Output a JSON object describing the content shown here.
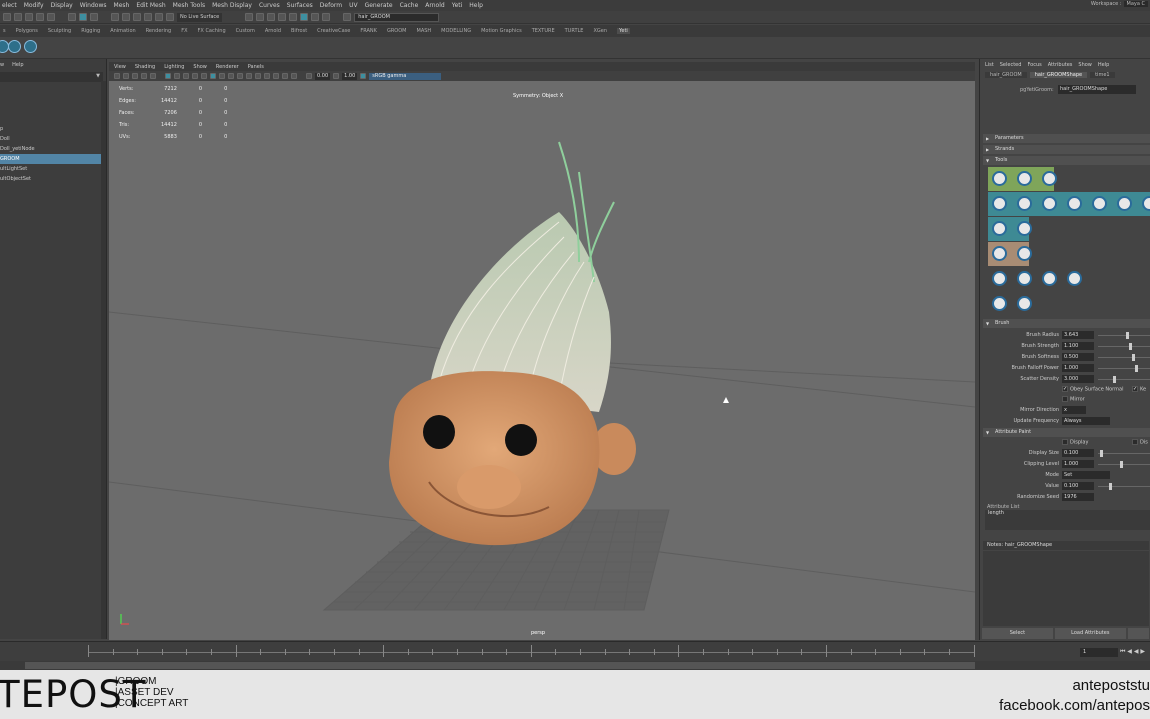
{
  "menubar": [
    "elect",
    "Modify",
    "Display",
    "Windows",
    "Mesh",
    "Edit Mesh",
    "Mesh Tools",
    "Mesh Display",
    "Curves",
    "Surfaces",
    "Deform",
    "UV",
    "Generate",
    "Cache",
    "Arnold",
    "Yeti",
    "Help"
  ],
  "workspace": {
    "label": "Workspace :",
    "value": "Maya C"
  },
  "toolbar": {
    "live_surface": "No Live Surface",
    "search_value": "hair_GROOM"
  },
  "shelf_tabs": [
    "s",
    "Polygons",
    "Sculpting",
    "Rigging",
    "Animation",
    "Rendering",
    "FX",
    "FX Caching",
    "Custom",
    "Arnold",
    "Bifrost",
    "CreativeCase",
    "FRANK",
    "GROOM",
    "MASH",
    "MODELLING",
    "Motion Graphics",
    "TEXTURE",
    "TURTLE",
    "XGen",
    "Yeti"
  ],
  "shelf_active": "Yeti",
  "outliner": {
    "menu": [
      "w",
      "Help"
    ],
    "items": [
      "",
      "",
      "",
      "",
      "p",
      "Doll",
      "Doll_yetiNode",
      "GROOM",
      "ultLightSet",
      "ultObjectSet"
    ],
    "selected_index": 7
  },
  "viewport": {
    "menu": [
      "View",
      "Shading",
      "Lighting",
      "Show",
      "Renderer",
      "Panels"
    ],
    "field1": "0.00",
    "field2": "1.00",
    "color_space": "sRGB gamma",
    "hud": [
      {
        "label": "Verts:",
        "v1": "7212",
        "v2": "0",
        "v3": "0"
      },
      {
        "label": "Edges:",
        "v1": "14412",
        "v2": "0",
        "v3": "0"
      },
      {
        "label": "Faces:",
        "v1": "7206",
        "v2": "0",
        "v3": "0"
      },
      {
        "label": "Tris:",
        "v1": "14412",
        "v2": "0",
        "v3": "0"
      },
      {
        "label": "UVs:",
        "v1": "5883",
        "v2": "0",
        "v3": "0"
      }
    ],
    "symmetry": "Symmetry: Object X",
    "camera": "persp"
  },
  "timeline": {
    "current_frame": "1"
  },
  "attribute_editor": {
    "menu": [
      "List",
      "Selected",
      "Focus",
      "Attributes",
      "Show",
      "Help"
    ],
    "tabs": [
      "hair_GROOM",
      "hair_GROOMShape",
      "time1"
    ],
    "active_tab": "hair_GROOMShape",
    "node_label": "pgYetiGroom:",
    "node_value": "hair_GROOMShape",
    "sections": {
      "parameters": "Parameters",
      "strands": "Strands",
      "tools": "Tools",
      "brush": "Brush",
      "attribute_paint": "Attribute Paint"
    },
    "tool_colors": {
      "green": "#7fa55a",
      "teal": "#3e8a94",
      "tan": "#a88c74",
      "gray": "#444444"
    },
    "tool_icons": [
      "add-icon",
      "remove-icon",
      "scatter-icon",
      "comb-icon",
      "cut-icon",
      "grab-icon",
      "twist-icon",
      "smooth-icon",
      "clump-icon",
      "fan-icon",
      "move-icon",
      "select-icon",
      "erase-icon",
      "scale-icon",
      "attract-icon",
      "direction-icon",
      "kill-icon",
      "lock-icon",
      "target-icon",
      "sculpt-icon",
      "undo-icon",
      "redo-icon"
    ],
    "brush": [
      {
        "label": "Brush Radius",
        "value": "3.643",
        "level": 0.55
      },
      {
        "label": "Brush Strength",
        "value": "1.100",
        "level": 0.62
      },
      {
        "label": "Brush Softness",
        "value": "0.500",
        "level": 0.68
      },
      {
        "label": "Brush Falloff Power",
        "value": "1.000",
        "level": 0.74
      },
      {
        "label": "Scatter Density",
        "value": "3.000",
        "level": 0.3
      }
    ],
    "obey_surface_normal": "Obey Surface Normal",
    "ke_label": "Ke",
    "mirror_label": "Mirror",
    "mirror_direction": {
      "label": "Mirror Direction",
      "value": "x"
    },
    "update_frequency": {
      "label": "Update Frequency",
      "value": "Always"
    },
    "display_label": "Display",
    "dis_label": "Dis",
    "display_size": {
      "label": "Display Size",
      "value": "0.100"
    },
    "clipping_level": {
      "label": "Clipping Level",
      "value": "1.000"
    },
    "mode": {
      "label": "Mode",
      "value": "Set"
    },
    "value": {
      "label": "Value",
      "value": "0.100"
    },
    "randomize_seed": {
      "label": "Randomize Seed",
      "value": "1976"
    },
    "attribute_list_label": "Attribute List",
    "attribute_list_item": "length",
    "notes": "Notes: hair_GROOMShape",
    "buttons": [
      "Select",
      "Load Attributes"
    ]
  },
  "branding": {
    "logo": "TEPOST",
    "lines": [
      "|GROOM",
      "|ASSET DEV",
      "|CONCEPT ART"
    ],
    "right1": "antepoststu",
    "right2": "facebook.com/antepos"
  }
}
